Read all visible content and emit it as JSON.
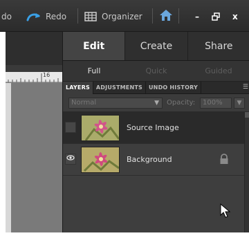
{
  "menubar": {
    "undo_label": "do",
    "redo_label": "Redo",
    "organizer_label": "Organizer",
    "home_icon": "home-icon",
    "minimize_glyph": "–",
    "restore_glyph": "❐",
    "close_glyph": "x"
  },
  "ruler": {
    "label": "16"
  },
  "mode_tabs": [
    {
      "label": "Edit",
      "active": true
    },
    {
      "label": "Create",
      "active": false
    },
    {
      "label": "Share",
      "active": false
    }
  ],
  "sub_tabs": [
    {
      "label": "Full",
      "active": true
    },
    {
      "label": "Quick",
      "active": false
    },
    {
      "label": "Guided",
      "active": false
    }
  ],
  "panel_tabs": [
    {
      "label": "LAYERS",
      "active": true
    },
    {
      "label": "ADJUSTMENTS",
      "active": false
    },
    {
      "label": "UNDO HISTORY",
      "active": false
    }
  ],
  "panel_menu_glyph": "☰",
  "blend": {
    "value": "Normal",
    "opacity_label": "Opacity:",
    "opacity_value": "100%"
  },
  "layers": [
    {
      "name": "Source Image",
      "visible": false,
      "locked": false,
      "selected": true
    },
    {
      "name": "Background",
      "visible": true,
      "locked": true,
      "selected": false
    }
  ],
  "colors": {
    "panel_bg": "#3b3b3b",
    "selected_row": "#2a2a2a",
    "redo_arrow": "#3aa0e6",
    "home_icon": "#6aa6dc"
  }
}
